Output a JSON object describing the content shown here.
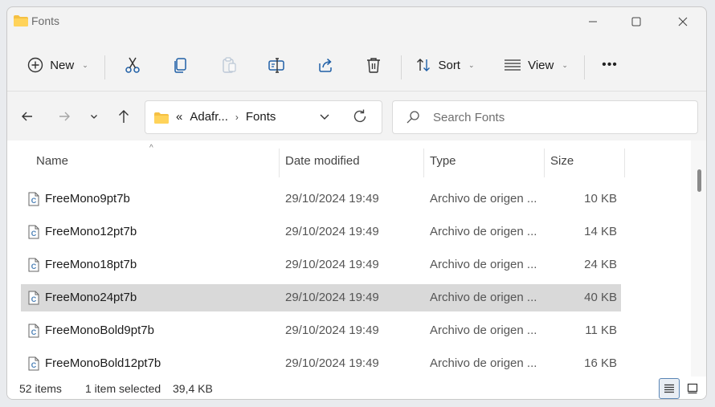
{
  "window": {
    "title": "Fonts"
  },
  "toolbar": {
    "new_label": "New",
    "sort_label": "Sort",
    "view_label": "View",
    "more_label": "•••"
  },
  "address": {
    "overflow": "«",
    "crumbs": [
      "Adafr...",
      "Fonts"
    ]
  },
  "search": {
    "placeholder": "Search Fonts"
  },
  "columns": {
    "name": "Name",
    "date": "Date modified",
    "type": "Type",
    "size": "Size"
  },
  "files": [
    {
      "name": "FreeMono9pt7b",
      "date": "29/10/2024 19:49",
      "type": "Archivo de origen ...",
      "size": "10 KB",
      "selected": false
    },
    {
      "name": "FreeMono12pt7b",
      "date": "29/10/2024 19:49",
      "type": "Archivo de origen ...",
      "size": "14 KB",
      "selected": false
    },
    {
      "name": "FreeMono18pt7b",
      "date": "29/10/2024 19:49",
      "type": "Archivo de origen ...",
      "size": "24 KB",
      "selected": false
    },
    {
      "name": "FreeMono24pt7b",
      "date": "29/10/2024 19:49",
      "type": "Archivo de origen ...",
      "size": "40 KB",
      "selected": true
    },
    {
      "name": "FreeMonoBold9pt7b",
      "date": "29/10/2024 19:49",
      "type": "Archivo de origen ...",
      "size": "11 KB",
      "selected": false
    },
    {
      "name": "FreeMonoBold12pt7b",
      "date": "29/10/2024 19:49",
      "type": "Archivo de origen ...",
      "size": "16 KB",
      "selected": false
    }
  ],
  "status": {
    "item_count": "52 items",
    "selection": "1 item selected",
    "selection_size": "39,4 KB"
  },
  "colors": {
    "folder": "#f5c043",
    "accent": "#1f5fa6",
    "selected_row": "#d9d9d9"
  }
}
